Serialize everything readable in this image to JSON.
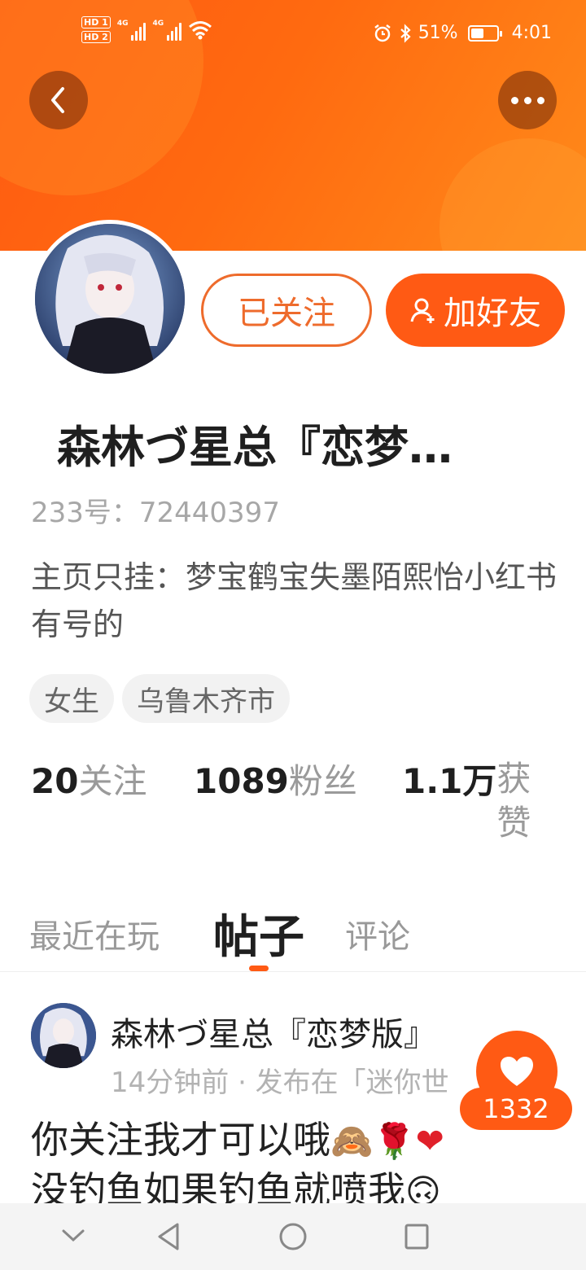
{
  "status_bar": {
    "hd1": "HD 1",
    "hd2": "HD 2",
    "net1": "4G",
    "net2": "4G",
    "battery_pct_text": "51%",
    "battery_level": 0.51,
    "time": "4:01"
  },
  "header": {
    "back_icon": "chevron-left-icon",
    "more_icon": "more-icon",
    "accent_color": "#ff5a14"
  },
  "profile": {
    "followed_label": "已关注",
    "add_friend_label": "加好友",
    "name": "森林づ星总『恋梦…",
    "uid": "233号：72440397",
    "bio": "主页只挂：梦宝鹤宝失墨陌熙怡小红书有号的",
    "tags": [
      "女生",
      "乌鲁木齐市"
    ],
    "stats": {
      "following_num": "20",
      "following_label": "关注",
      "fans_num": "1089",
      "fans_label": "粉丝",
      "likes_num": "1.1万",
      "likes_label": "获赞"
    }
  },
  "tabs": [
    "最近在玩",
    "帖子",
    "评论"
  ],
  "active_tab": "帖子",
  "post": {
    "author": "森林づ星总『恋梦版』",
    "meta": "14分钟前 · 发布在「迷你世",
    "line1": "你关注我才可以哦",
    "line2": "没钓鱼如果钓鱼就喷我",
    "like_count": "1332"
  }
}
